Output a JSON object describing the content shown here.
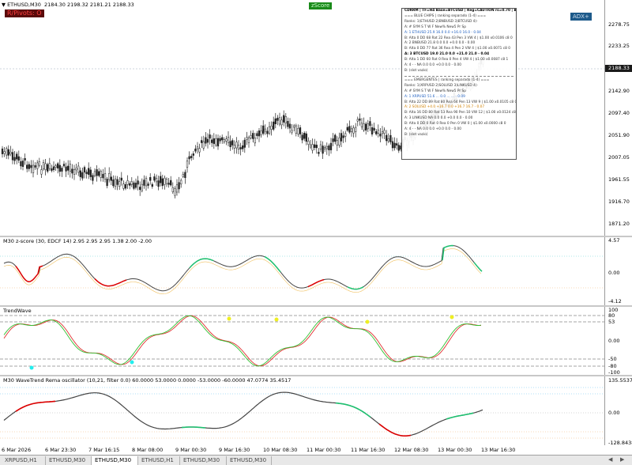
{
  "header": {
    "symbol_text": "ETHUSD,M30",
    "ohlc": "2184.30 2198.32 2181.21 2188.33"
  },
  "badges": {
    "r_pivots": "R/Pivots: O",
    "zscore": "zScore",
    "adx": "ADX+"
  },
  "main_axis": {
    "labels": [
      "2278.75",
      "2233.25",
      "2188.33",
      "2142.90",
      "2097.40",
      "2051.90",
      "2007.05",
      "1961.55",
      "1916.70",
      "1871.20"
    ],
    "current_price": "2188.33"
  },
  "zscore": {
    "title": "M30 z-score (30,  EDCF  14) 2.95 2.95 2.95 1.38 2.00 -2.00",
    "axis": [
      "4.57",
      "0.00",
      "-4.12"
    ]
  },
  "trendwave": {
    "title": "TrendWave",
    "axis": [
      "100",
      "80",
      "53",
      "0.00",
      "-50",
      "-80",
      "-100"
    ]
  },
  "wavetrend": {
    "title": "M30 WaveTrend Rema oscillator (10,21, filter 0.0) 60.0000 53.0000 0.0000 -53.0000 -60.0000 47.0774 35.4517",
    "axis": [
      "135.5537",
      "0.00",
      "-128.8438"
    ]
  },
  "xaxis": {
    "labels": [
      "6 Mar 2026",
      "6 Mar 23:30",
      "7 Mar 16:15",
      "8 Mar 08:00",
      "9 Mar 00:30",
      "9 Mar 16:30",
      "10 Mar 08:30",
      "11 Mar 00:30",
      "11 Mar 16:30",
      "12 Mar 08:30",
      "13 Mar 00:30",
      "13 Mar 16:30"
    ]
  },
  "tabs": [
    "XRPUSD,H1",
    "ETHUSD,M30",
    "ETHUSD,M30",
    "ETHUSD,H1",
    "ETHUSD,M30",
    "ETHUSD,M30"
  ],
  "active_tab_index": 2,
  "panel": {
    "lines": [
      "CDRRM | TF=H4 Base=BTCUSD | Reg=CAUTION rs=0.70 | BTC+=0.034 Cor",
      "=== BLUE CHIPS | ranking separado (1-4) ===",
      "Ranks: 1)ETHUSD 2)BNBUSD 3)BTCUSD 4)-",
      "A: # SYM       S     T     W     F    New%   New5     Pr    Sp",
      "A: 1 ETHUSD    25.9  16.0  0.0 +16.0  16.0   -     0.04",
      "B: Alta  0 DD 68 Rat 22 Rea 43 Pen  3 VW  4 | $1.00 x0.0106 c8 0",
      "A: 2 BNBUSD    21.8  0.0   0.0 +0.0   0.0   -     0.00",
      "B: Alta  0 DD 77 Rat 36 Rea  4 Pen  2 VW  4 | $1.00 x0.0071 c8 0",
      "A: 3 BTCUSD    19.0  21.0  0.0 +21.0  21.0   -     0.04",
      "B: Alta  1 DD 60 Rat  0 Rea  0 Pen  4 VW  4 | $1.00 x0.0087 c8 1",
      "A: 4 -         -     NA    0.0  0.0  +0.0   0.0   -     0.00",
      "B: (slot vazio)",
      "",
      "=== EMERGENTES | ranking separado (1-4) ===",
      "Ranks: 1)XRPUSD 2)SOLUSD 3)LINKUSD 4)-",
      "A: # SYM       S     T     W     F    New%   New5     Pr    Sp",
      "A: 1 XRPUSD    51.6  ...   0.0  ...   ...   -     0.09",
      "B: Alta 22 DD 89 Rat 80 Rea 64 Pen 13 VW  9 | $1.00 x0.0105 c8 0",
      "A: 2 SOLUSD    +4.0  +16.7  0.0 +16.7  16.7   -     0.07",
      "B: Alta 16 DD 80 Rat 53 Rea 90 Pen 10 VW 12 | $1.00 x0.0124 c8 0",
      "A: 3 LINKUSD   NA    0.0   0.0  +0.0   0.0   -     0.00",
      "B: Alta  0 DD  0 Rat  0 Rea  0 Pen  0 VW  0 | $1.00 x0.0000 c8 0",
      "A: 4 -         -     NA    0.0  0.0  +0.0   0.0   -     0.00",
      "B: (slot vazio)"
    ]
  }
}
